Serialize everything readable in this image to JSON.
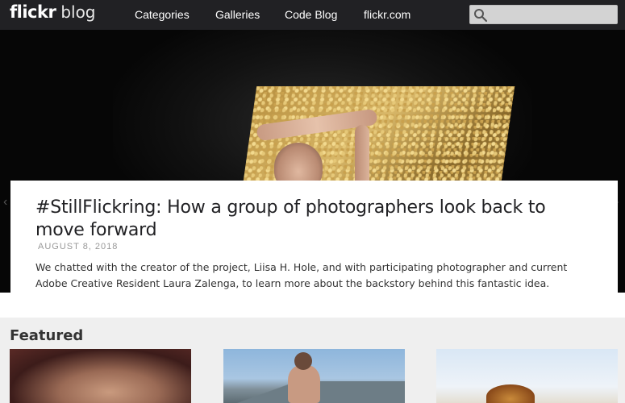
{
  "header": {
    "logo_main": "flickr",
    "logo_sub": "blog",
    "nav": [
      {
        "label": "Categories"
      },
      {
        "label": "Galleries"
      },
      {
        "label": "Code Blog"
      },
      {
        "label": "flickr.com"
      }
    ],
    "search": {
      "placeholder": "",
      "value": ""
    }
  },
  "hero": {
    "image_icon": "hero-photo",
    "prev_icon": "chevron-left-icon",
    "next_icon": "chevron-right-icon"
  },
  "article": {
    "title": "#StillFlickring: How a group of photographers look back to move forward",
    "date": "AUGUST 8, 2018",
    "excerpt": "We chatted with the creator of the project, Liisa H. Hole, and with participating photographer and current Adobe Creative Resident Laura Zalenga, to learn more about the backstory behind this fantastic idea."
  },
  "featured": {
    "heading": "Featured",
    "items": [
      {
        "thumb": "featured-thumb-1"
      },
      {
        "thumb": "featured-thumb-2"
      },
      {
        "thumb": "featured-thumb-3"
      }
    ]
  },
  "colors": {
    "header_bg": "#212124",
    "search_bg": "#d3d3d3",
    "featured_bg": "#efefef",
    "text_dark": "#212124",
    "date_gray": "#999999"
  }
}
